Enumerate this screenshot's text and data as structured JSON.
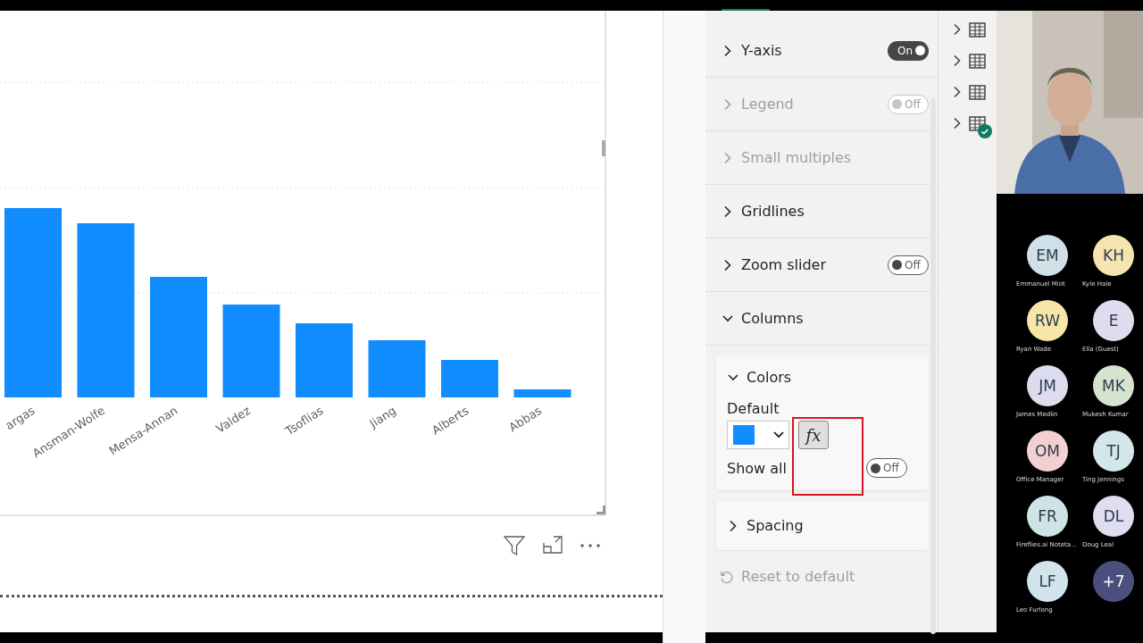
{
  "chart": {
    "x_labels": [
      "argas",
      "Ansman-Wolfe",
      "Mensa-Annan",
      "Valdez",
      "Tsoflias",
      "Jiang",
      "Alberts",
      "Abbas"
    ]
  },
  "format_pane": {
    "sections": [
      {
        "label": "Y-axis",
        "kind": "toggle",
        "on": true,
        "disabled": false,
        "expanded": false,
        "toggle_text": "On"
      },
      {
        "label": "Legend",
        "kind": "toggle",
        "on": false,
        "disabled": true,
        "expanded": false,
        "toggle_text": "Off"
      },
      {
        "label": "Small multiples",
        "kind": "plain",
        "disabled": true,
        "expanded": false
      },
      {
        "label": "Gridlines",
        "kind": "plain",
        "disabled": false,
        "expanded": false
      },
      {
        "label": "Zoom slider",
        "kind": "toggle",
        "on": false,
        "disabled": false,
        "expanded": false,
        "toggle_text": "Off"
      },
      {
        "label": "Columns",
        "kind": "plain",
        "disabled": false,
        "expanded": true
      }
    ],
    "colors_card": {
      "title": "Colors",
      "expanded": true,
      "default_label": "Default",
      "fx_label": "fx",
      "show_all_label": "Show all",
      "show_all": {
        "on": false,
        "toggle_text": "Off"
      }
    },
    "spacing_card": {
      "title": "Spacing",
      "expanded": false
    },
    "reset_label": "Reset to default"
  },
  "fields_pane": {
    "tables": [
      {
        "checked": false
      },
      {
        "checked": false
      },
      {
        "checked": false
      },
      {
        "checked": true
      }
    ]
  },
  "participants": [
    {
      "initials": "EM",
      "name": "Emmanuel Miot",
      "color": "#cfe0e6"
    },
    {
      "initials": "KH",
      "name": "Kyle Hale",
      "color": "#f5e3b0"
    },
    {
      "initials": "RW",
      "name": "Ryan Wade",
      "color": "#f7e6a8"
    },
    {
      "initials": "E",
      "name": "Ella (Guest)",
      "color": "#e0dcef"
    },
    {
      "initials": "JM",
      "name": "James Medlin",
      "color": "#dddcef"
    },
    {
      "initials": "MK",
      "name": "Mukesh Kumar",
      "color": "#d6e3cf"
    },
    {
      "initials": "OM",
      "name": "Office Manager",
      "color": "#f2d0d2"
    },
    {
      "initials": "TJ",
      "name": "Ting Jennings",
      "color": "#d3e6ea"
    },
    {
      "initials": "FR",
      "name": "Fireflies.ai Noteta...",
      "color": "#cfe3e6"
    },
    {
      "initials": "DL",
      "name": "Doug Leal",
      "color": "#e1dcef"
    },
    {
      "initials": "LF",
      "name": "Leo Furlong",
      "color": "#d2e3ec"
    },
    {
      "initials": "+7",
      "kind": "overflow",
      "color": "#4b4f7d"
    }
  ]
}
